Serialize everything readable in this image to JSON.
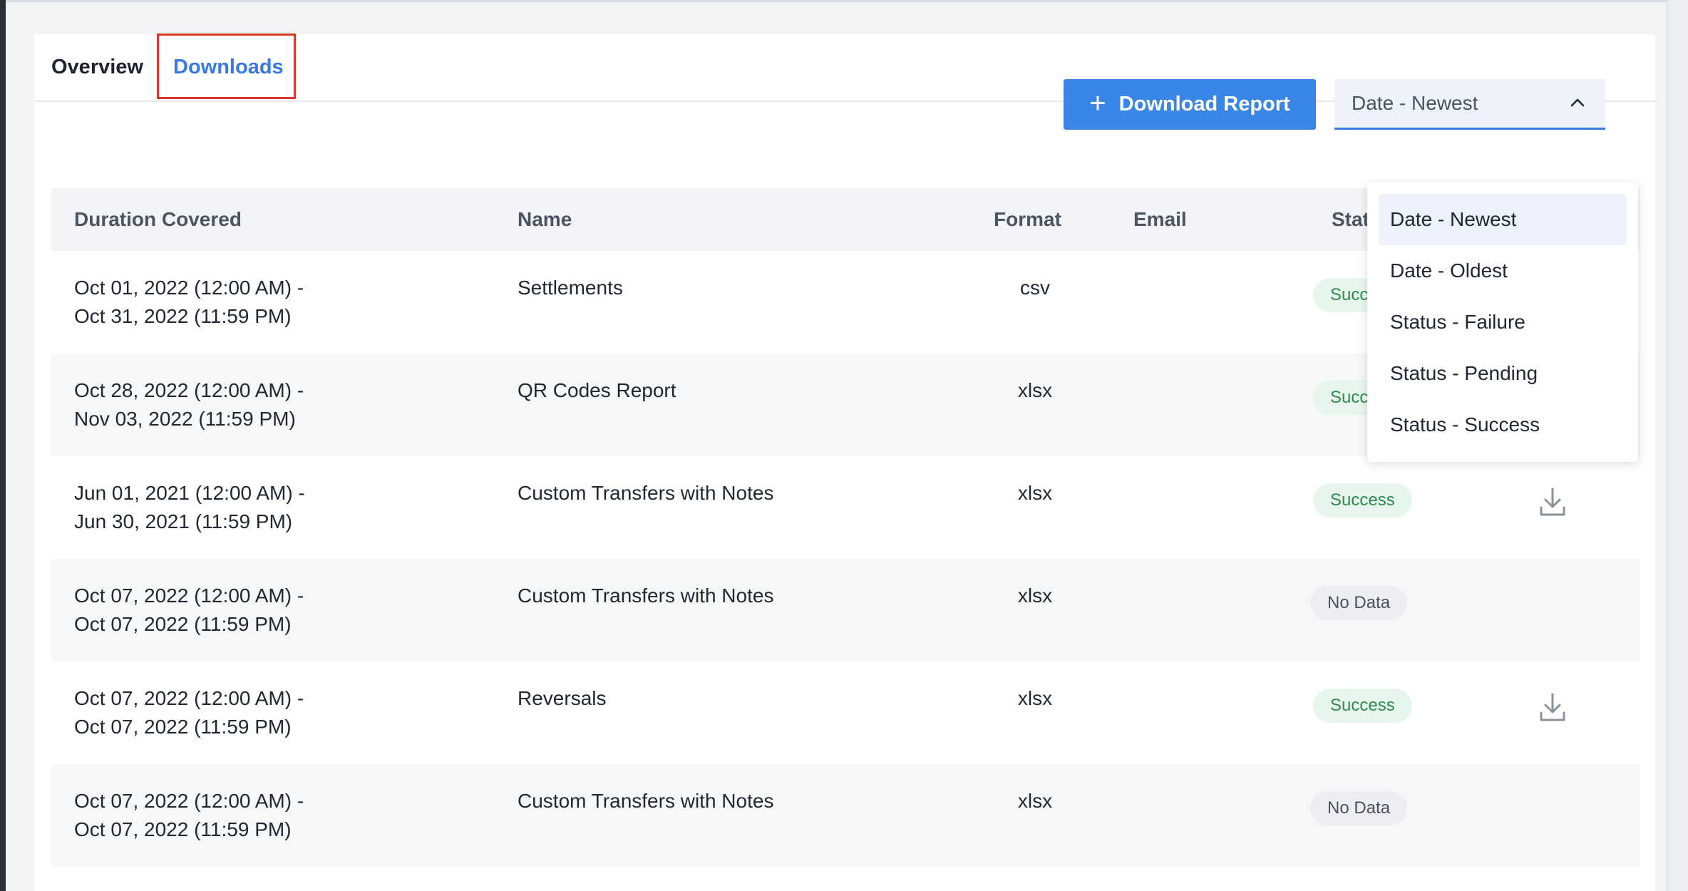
{
  "tabs": [
    {
      "label": "Overview"
    },
    {
      "label": "Downloads"
    }
  ],
  "toolbar": {
    "download_label": "Download Report",
    "sort_value": "Date - Newest"
  },
  "table": {
    "headers": {
      "duration": "Duration Covered",
      "name": "Name",
      "format": "Format",
      "email": "Email",
      "status": "Stat"
    },
    "rows": [
      {
        "from": "Oct 01, 2022 (12:00 AM) -",
        "to": "Oct 31, 2022 (11:59 PM)",
        "name": "Settlements",
        "format": "csv",
        "status": "Succ"
      },
      {
        "from": "Oct 28, 2022 (12:00 AM) -",
        "to": "Nov 03, 2022 (11:59 PM)",
        "name": "QR Codes Report",
        "format": "xlsx",
        "status": "Succ"
      },
      {
        "from": "Jun 01, 2021 (12:00 AM) -",
        "to": "Jun 30, 2021 (11:59 PM)",
        "name": "Custom Transfers with Notes",
        "format": "xlsx",
        "status": "Success"
      },
      {
        "from": "Oct 07, 2022 (12:00 AM) -",
        "to": "Oct 07, 2022 (11:59 PM)",
        "name": "Custom Transfers with Notes",
        "format": "xlsx",
        "status": "No Data"
      },
      {
        "from": "Oct 07, 2022 (12:00 AM) -",
        "to": "Oct 07, 2022 (11:59 PM)",
        "name": "Reversals",
        "format": "xlsx",
        "status": "Success"
      },
      {
        "from": "Oct 07, 2022 (12:00 AM) -",
        "to": "Oct 07, 2022 (11:59 PM)",
        "name": "Custom Transfers with Notes",
        "format": "xlsx",
        "status": "No Data"
      }
    ]
  },
  "sort_options": [
    {
      "label": "Date - Newest"
    },
    {
      "label": "Date - Oldest"
    },
    {
      "label": "Status - Failure"
    },
    {
      "label": "Status - Pending"
    },
    {
      "label": "Status - Success"
    }
  ],
  "colors": {
    "accent": "#3a86e8",
    "active_tab": "#3a78e8",
    "highlight_outline": "#d8382b",
    "success_text": "#2f8a4f",
    "success_bg": "#e7f6ec"
  }
}
